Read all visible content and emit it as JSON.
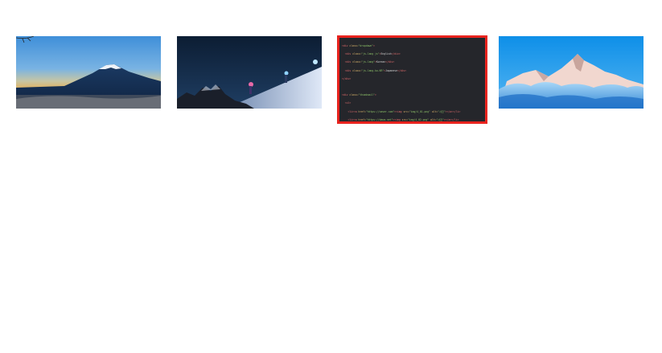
{
  "gallery": {
    "thumbnails": [
      {
        "name": "thumbnail-mount-fuji",
        "subject": "mountain-at-sunset"
      },
      {
        "name": "thumbnail-night-hikers",
        "subject": "hikers-on-snowy-ridge-at-night"
      },
      {
        "name": "thumbnail-code-snippet",
        "subject": "code-screenshot",
        "selected": true
      },
      {
        "name": "thumbnail-mountain-clouds",
        "subject": "mountain-above-clouds"
      }
    ],
    "selection_border_color": "#e8231e",
    "code_background_color": "#25262b"
  }
}
